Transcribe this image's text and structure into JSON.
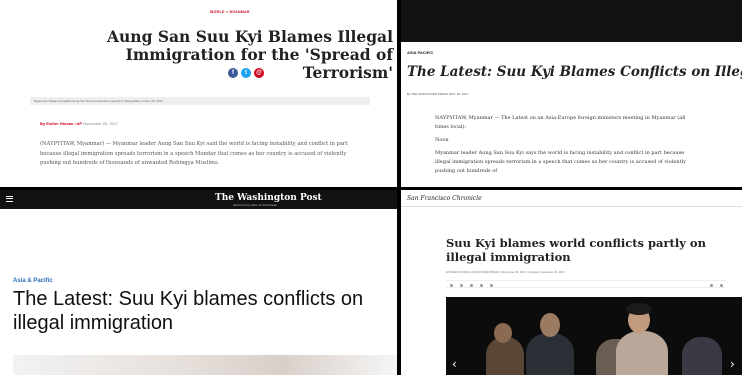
{
  "panels": {
    "p1": {
      "kicker": "WORLD > MYANMAR",
      "headline": "Aung San Suu Kyi Blames Illegal Immigration for the 'Spread of Terrorism'",
      "share_icons": [
        "f",
        "t",
        "@"
      ],
      "share_colors": [
        "#3b5998",
        "#1da1f2",
        "#d0021b"
      ],
      "caption": "Myanmar's State Counsellor Aung San Suu Kyi delivers a speech in Naypyidaw on Nov. 20, 2017.",
      "byline_author": "By Esther Htusan / AP",
      "byline_date": "November 20, 2017",
      "body": "(NAYPYITAW, Myanmar) — Myanmar leader Aung San Suu Kyi said the world is facing instability and conflict in part because illegal immigration spreads terrorism in a speech Monday that comes as her country is accused of violently pushing out hundreds of thousands of unwanted Rohingya Muslims."
    },
    "p2": {
      "section": "ASIA PACIFIC",
      "headline": "The Latest: Suu Kyi Blames Conflicts on Illegal Immigration",
      "byline": "By THE ASSOCIATED PRESS   NOV. 20, 2017",
      "paragraphs": [
        "NAYPYITAW, Myanmar — The Latest on an Asia-Europe foreign ministers meeting in Myanmar (all times local):",
        "Noon",
        "Myanmar leader Aung San Suu Kyi says the world is facing instability and conflict in part because illegal immigration spreads terrorism in a speech that comes as her country is accused of violently pushing out hundreds of"
      ]
    },
    "p3": {
      "menu_icon": "hamburger-menu-icon",
      "masthead": "The Washington Post",
      "tagline": "Democracy Dies in Darkness",
      "section": "Asia & Pacific",
      "headline": "The Latest: Suu Kyi blames conflicts on illegal immigration"
    },
    "p4": {
      "masthead": "San Francisco Chronicle",
      "headline": "Suu Kyi blames world conflicts partly on illegal immigration",
      "byline": "ESTHER HTUSAN, ASSOCIATED PRESS | November 20, 2017 | Updated: November 20, 2017",
      "prev_arrow": "‹",
      "next_arrow": "›"
    }
  }
}
